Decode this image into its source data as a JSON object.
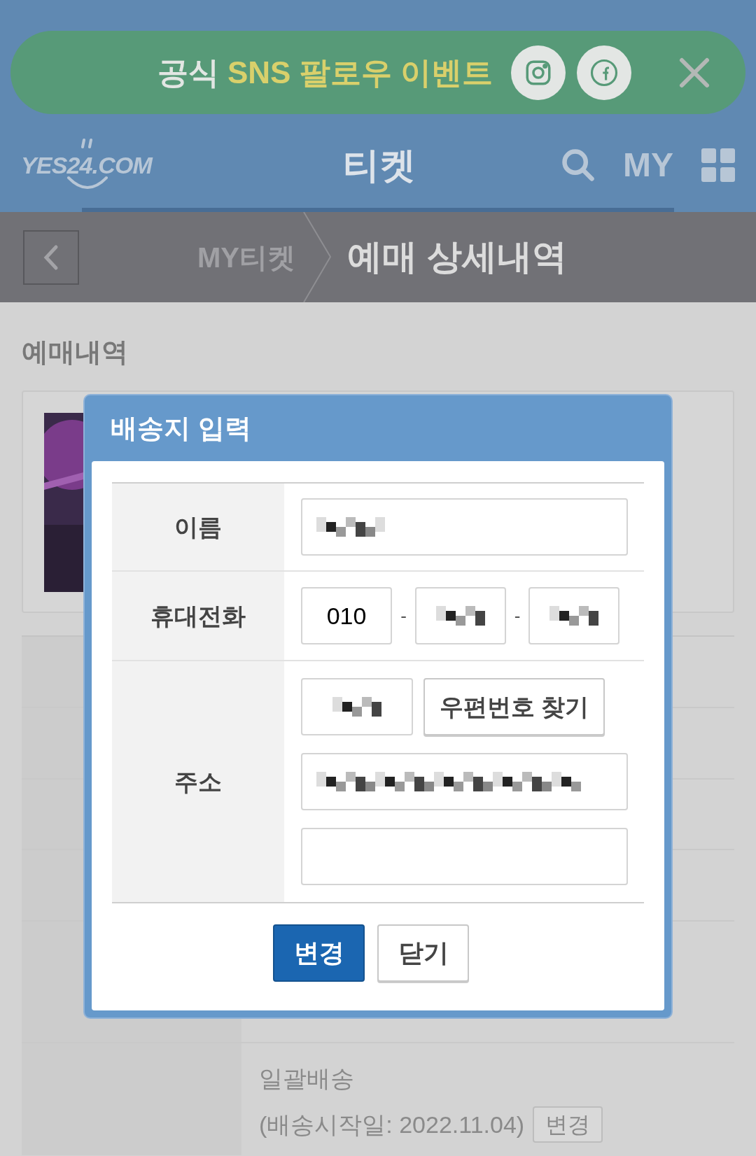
{
  "banner": {
    "parts": [
      {
        "text": "공식",
        "highlight": false
      },
      {
        "text": "SNS 팔로우 이벤트",
        "highlight": true
      }
    ]
  },
  "header": {
    "logo": "YES24.COM",
    "title": "티켓",
    "my": "MY"
  },
  "breadcrumb": {
    "parent": "MY티켓",
    "current": "예매 상세내역"
  },
  "section_title": "예매내역",
  "delivery": {
    "method": "일괄배송",
    "start_date": "(배송시작일: 2022.11.04)",
    "button": "변경"
  },
  "modal": {
    "title": "배송지 입력",
    "fields": [
      {
        "label": "이름",
        "kind": "name"
      },
      {
        "label": "휴대전화",
        "kind": "phone",
        "prefix": "010",
        "separators": [
          "-",
          "-"
        ]
      },
      {
        "label": "주소",
        "kind": "address",
        "zip_button": "우편번호 찾기"
      }
    ],
    "buttons": [
      {
        "label": "변경",
        "primary": true
      },
      {
        "label": "닫기",
        "primary": false
      }
    ]
  }
}
